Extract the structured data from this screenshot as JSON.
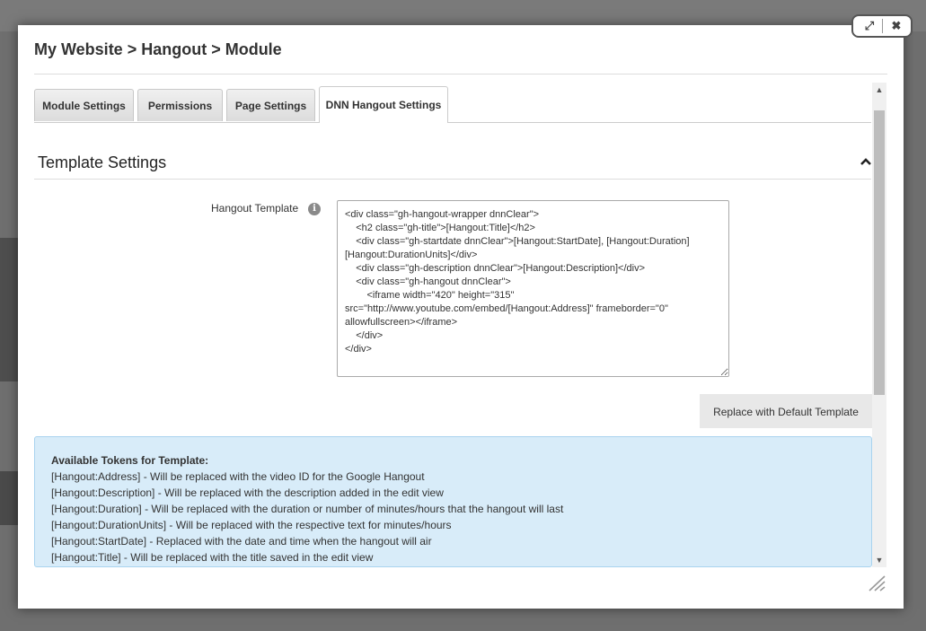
{
  "dialog": {
    "title": "My Website > Hangout > Module",
    "controls": {
      "maximize": "⤢",
      "close": "✖"
    }
  },
  "tabs": [
    {
      "label": "Module Settings",
      "active": false
    },
    {
      "label": "Permissions",
      "active": false
    },
    {
      "label": "Page Settings",
      "active": false
    },
    {
      "label": "DNN Hangout Settings",
      "active": true
    }
  ],
  "section": {
    "title": "Template Settings"
  },
  "template": {
    "label": "Hangout Template",
    "info": "i",
    "value": "<div class=\"gh-hangout-wrapper dnnClear\">\n\t<h2 class=\"gh-title\">[Hangout:Title]</h2>\n\t<div class=\"gh-startdate dnnClear\">[Hangout:StartDate], [Hangout:Duration] [Hangout:DurationUnits]</div>\n\t<div class=\"gh-description dnnClear\">[Hangout:Description]</div>\n\t<div class=\"gh-hangout dnnClear\">\n\t\t<iframe width=\"420\" height=\"315\" src=\"http://www.youtube.com/embed/[Hangout:Address]\" frameborder=\"0\" allowfullscreen></iframe>\n\t</div>\n</div>",
    "default_button": "Replace with Default Template"
  },
  "tokens": {
    "title": "Available Tokens for Template:",
    "items": [
      "[Hangout:Address] - Will be replaced with the video ID for the Google Hangout",
      "[Hangout:Description] - Will be replaced with the description added in the edit view",
      "[Hangout:Duration] - Will be replaced with the duration or number of minutes/hours that the hangout will last",
      "[Hangout:DurationUnits] - Will be replaced with the respective text for minutes/hours",
      "[Hangout:StartDate] - Replaced with the date and time when the hangout will air",
      "[Hangout:Title] - Will be replaced with the title saved in the edit view"
    ]
  },
  "colors": {
    "accent_panel": "#d8ecf9",
    "overlay": "#6f6f6f"
  }
}
